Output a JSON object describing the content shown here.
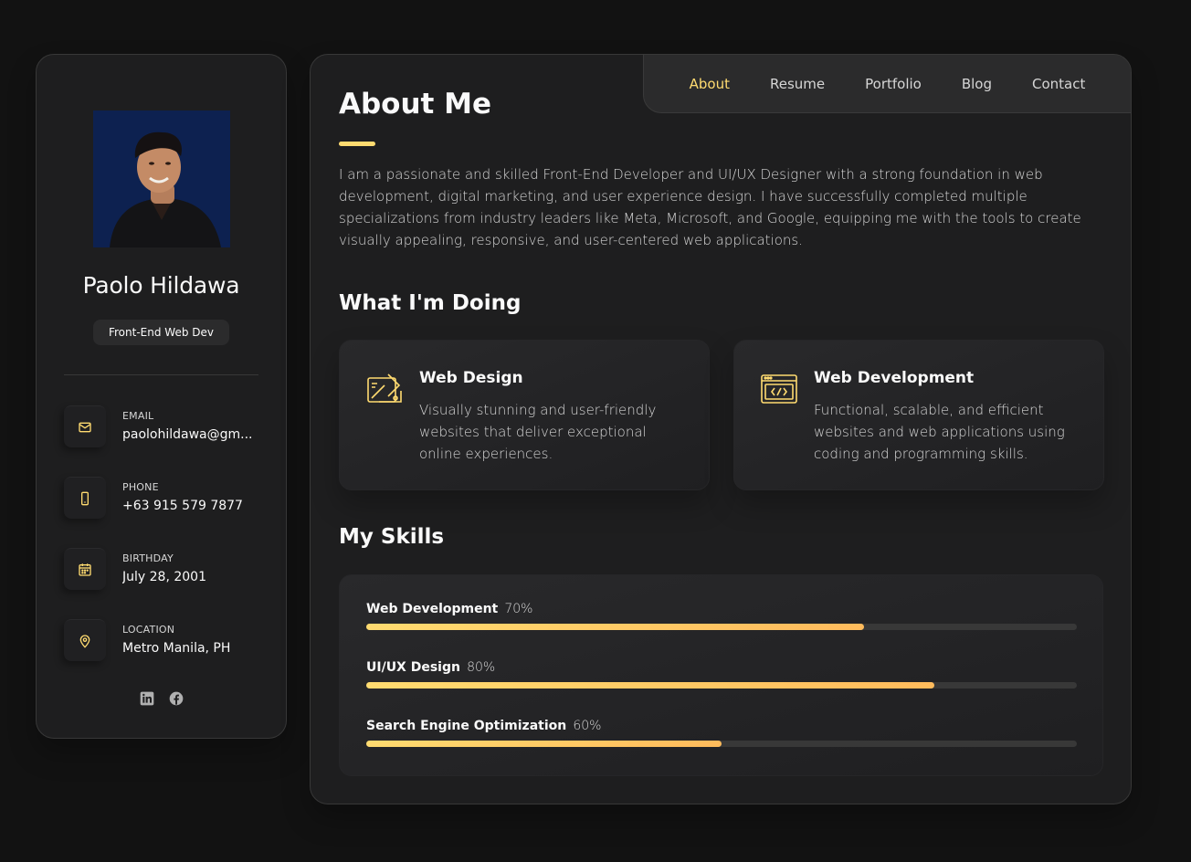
{
  "profile": {
    "name": "Paolo Hildawa",
    "title": "Front-End Web Dev"
  },
  "contacts": [
    {
      "label": "Email",
      "value": "paolohildawa@gm...",
      "icon": "mail-icon"
    },
    {
      "label": "Phone",
      "value": "+63 915 579 7877",
      "icon": "phone-icon"
    },
    {
      "label": "Birthday",
      "value": "July 28, 2001",
      "icon": "calendar-icon"
    },
    {
      "label": "Location",
      "value": "Metro Manila, PH",
      "icon": "location-icon"
    }
  ],
  "socials": [
    {
      "icon": "linkedin-icon"
    },
    {
      "icon": "facebook-icon"
    }
  ],
  "nav": {
    "items": [
      "About",
      "Resume",
      "Portfolio",
      "Blog",
      "Contact"
    ],
    "active": "About"
  },
  "about": {
    "title": "About Me",
    "text": "I am a passionate and skilled Front-End Developer and UI/UX Designer with a strong foundation in web development, digital marketing, and user experience design. I have successfully completed multiple specializations from industry leaders like Meta, Microsoft, and Google, equipping me with the tools to create visually appealing, responsive, and user-centered web applications."
  },
  "services": {
    "title": "What I'm Doing",
    "items": [
      {
        "title": "Web Design",
        "desc": "Visually stunning and user-friendly websites that deliver exceptional online experiences.",
        "icon": "design-icon"
      },
      {
        "title": "Web Development",
        "desc": "Functional, scalable, and efficient websites and web applications using coding and programming skills.",
        "icon": "code-icon"
      }
    ]
  },
  "skills": {
    "title": "My Skills",
    "items": [
      {
        "name": "Web Development",
        "percent_label": "70%",
        "level": 0.7
      },
      {
        "name": "UI/UX Design",
        "percent_label": "80%",
        "level": 0.8
      },
      {
        "name": "Search Engine Optimization",
        "percent_label": "60%",
        "level": 0.5
      }
    ]
  },
  "colors": {
    "accent": "#ffdb70",
    "background": "#121212",
    "card": "#1e1e1f"
  }
}
